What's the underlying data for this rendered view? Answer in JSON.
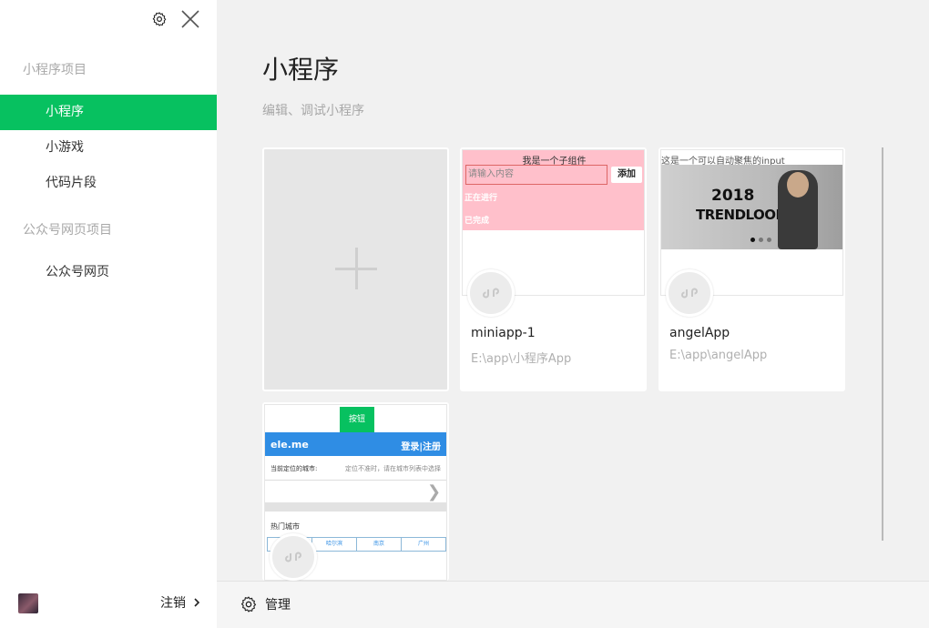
{
  "sidebar": {
    "section_miniprogram": "小程序项目",
    "items": [
      {
        "label": "小程序"
      },
      {
        "label": "小游戏"
      },
      {
        "label": "代码片段"
      }
    ],
    "section_web": "公众号网页项目",
    "web_items": [
      {
        "label": "公众号网页"
      }
    ],
    "logout_label": "注销"
  },
  "main": {
    "title": "小程序",
    "subtitle": "编辑、调试小程序",
    "projects": [
      {
        "name": "miniapp-1",
        "path": "E:\\app\\小程序App",
        "preview": {
          "header": "我是一个子组件",
          "input_placeholder": "请输入内容",
          "add_label": "添加",
          "status1": "正在进行",
          "status2": "已完成"
        }
      },
      {
        "name": "angelApp",
        "path": "E:\\app\\angelApp",
        "preview": {
          "header": "这是一个可以自动聚焦的input",
          "banner_year": "2018",
          "banner_title": "TRENDLOOK"
        }
      },
      {
        "name": "",
        "path": "",
        "preview": {
          "button": "按钮",
          "brand": "ele.me",
          "login": "登录|注册",
          "location": "当前定位的城市:",
          "hint": "定位不准时，请在城市列表中选择",
          "hot_cities": "热门城市",
          "cities": [
            "",
            "哈尔滨",
            "南京",
            "广州"
          ]
        }
      }
    ]
  },
  "footer": {
    "manage_label": "管理"
  },
  "colors": {
    "accent": "#07c160",
    "preview_pink": "#ffc0cb",
    "preview_blue": "#2f8de4"
  }
}
